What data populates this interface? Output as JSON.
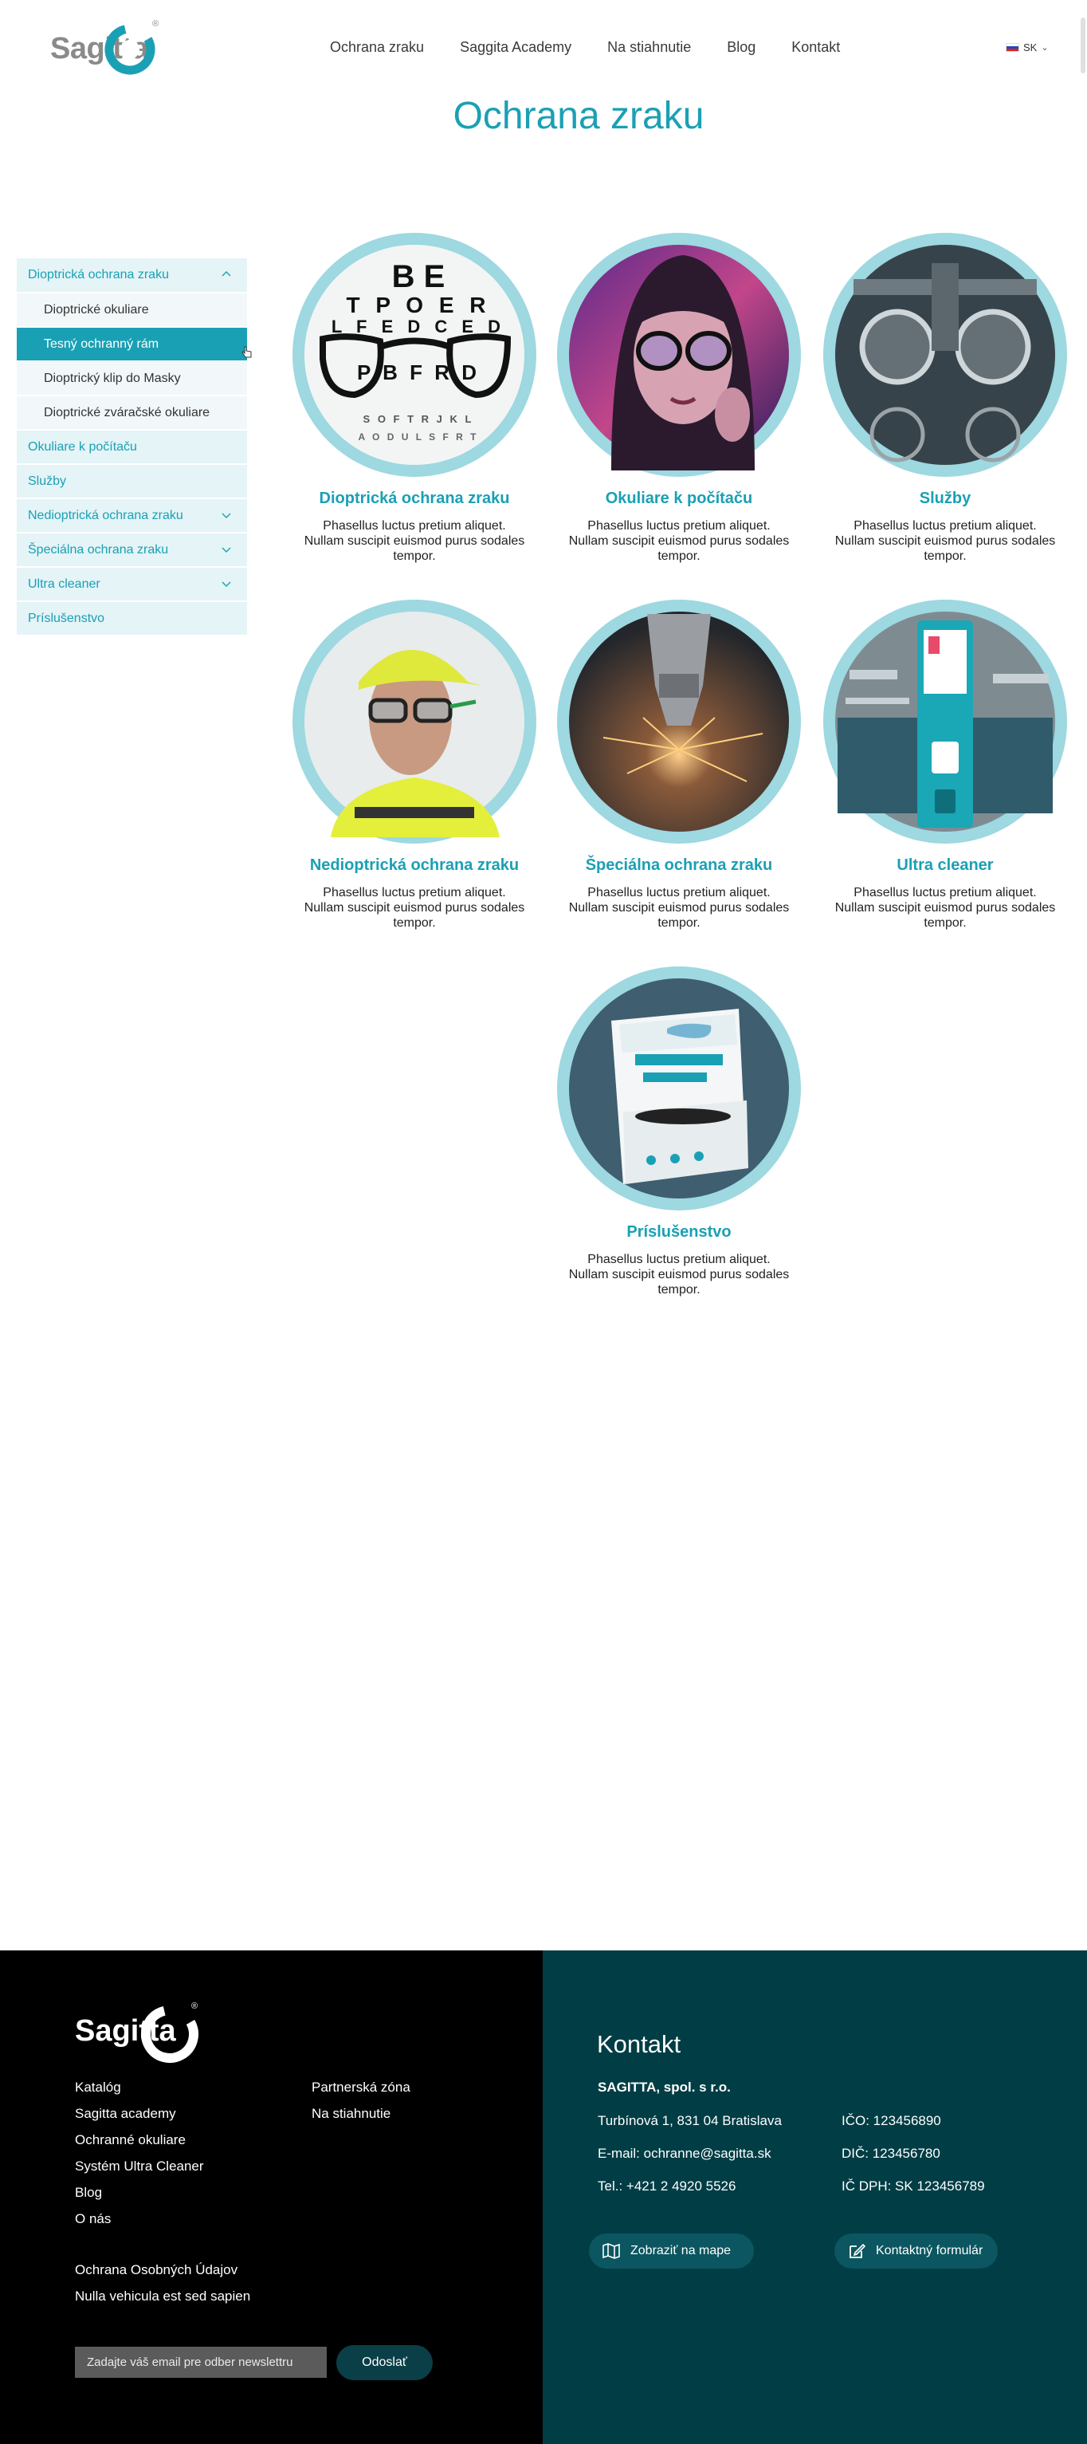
{
  "header": {
    "logo_text": "Sagitta",
    "logo_reg": "®",
    "nav": [
      "Ochrana zraku",
      "Saggita Academy",
      "Na stiahnutie",
      "Blog",
      "Kontakt"
    ],
    "lang": "SK"
  },
  "page_title": "Ochrana zraku",
  "sidebar": {
    "sections": [
      {
        "label": "Dioptrická ochrana zraku",
        "expanded": true,
        "children": [
          "Dioptrické okuliare",
          "Tesný ochranný rám",
          "Dioptrický klip do Masky",
          "Dioptrické zváračské okuliare"
        ],
        "active_child": "Tesný ochranný rám"
      },
      {
        "label": "Okuliare k počítaču"
      },
      {
        "label": "Služby"
      },
      {
        "label": "Nedioptrická ochrana zraku"
      },
      {
        "label": "Špeciálna ochrana zraku"
      },
      {
        "label": "Ultra cleaner"
      },
      {
        "label": "Príslušenstvo"
      }
    ]
  },
  "cards": [
    {
      "title": "Dioptrická ochrana zraku",
      "desc": "Phasellus luctus pretium aliquet. Nullam suscipit euismod purus sodales tempor.",
      "image": "eye-chart-glasses-photo"
    },
    {
      "title": "Okuliare k počítaču",
      "desc": "Phasellus luctus pretium aliquet. Nullam suscipit euismod purus sodales tempor.",
      "image": "woman-computer-glasses-photo"
    },
    {
      "title": "Služby",
      "desc": "Phasellus luctus pretium aliquet. Nullam suscipit euismod purus sodales tempor.",
      "image": "trial-frame-photo"
    },
    {
      "title": "Nedioptrická ochrana zraku",
      "desc": "Phasellus luctus pretium aliquet. Nullam suscipit euismod purus sodales tempor.",
      "image": "worker-safety-glasses-photo"
    },
    {
      "title": "Špeciálna ochrana zraku",
      "desc": "Phasellus luctus pretium aliquet. Nullam suscipit euismod purus sodales tempor.",
      "image": "laser-cutting-photo"
    },
    {
      "title": "Ultra cleaner",
      "desc": "Phasellus luctus pretium aliquet. Nullam suscipit euismod purus sodales tempor.",
      "image": "cleaning-station-photo"
    },
    {
      "title": "Príslušenstvo",
      "desc": "Phasellus luctus pretium aliquet. Nullam suscipit euismod purus sodales tempor.",
      "image": "wipes-box-photo"
    }
  ],
  "footer": {
    "logo_text": "Sagitta",
    "logo_reg": "®",
    "links_col1": [
      "Katalóg",
      "Sagitta academy",
      "Ochranné okuliare",
      "Systém Ultra Cleaner",
      "Blog",
      "O nás"
    ],
    "links_col2": [
      "Partnerská zóna",
      "Na stiahnutie"
    ],
    "links_legal": [
      "Ochrana Osobných Údajov",
      "Nulla vehicula est sed sapien"
    ],
    "newsletter_placeholder": "Zadajte váš email pre odber newslettru",
    "newsletter_button": "Odoslať",
    "contact": {
      "title": "Kontakt",
      "company": "SAGITTA, spol. s r.o.",
      "address": "Turbínová 1, 831 04  Bratislava",
      "email": "E-mail: ochranne@sagitta.sk",
      "phone": "Tel.: +421 2 4920 5526",
      "ico": "IČO: 123456890",
      "dic": "DIČ: 123456780",
      "icdph": "IČ DPH: SK 123456789",
      "map_button": "Zobraziť na mape",
      "form_button": "Kontaktný formulár"
    }
  },
  "colors": {
    "accent": "#1aa0b4",
    "ring": "#9ed8e1",
    "footer_dark": "#003d45"
  }
}
